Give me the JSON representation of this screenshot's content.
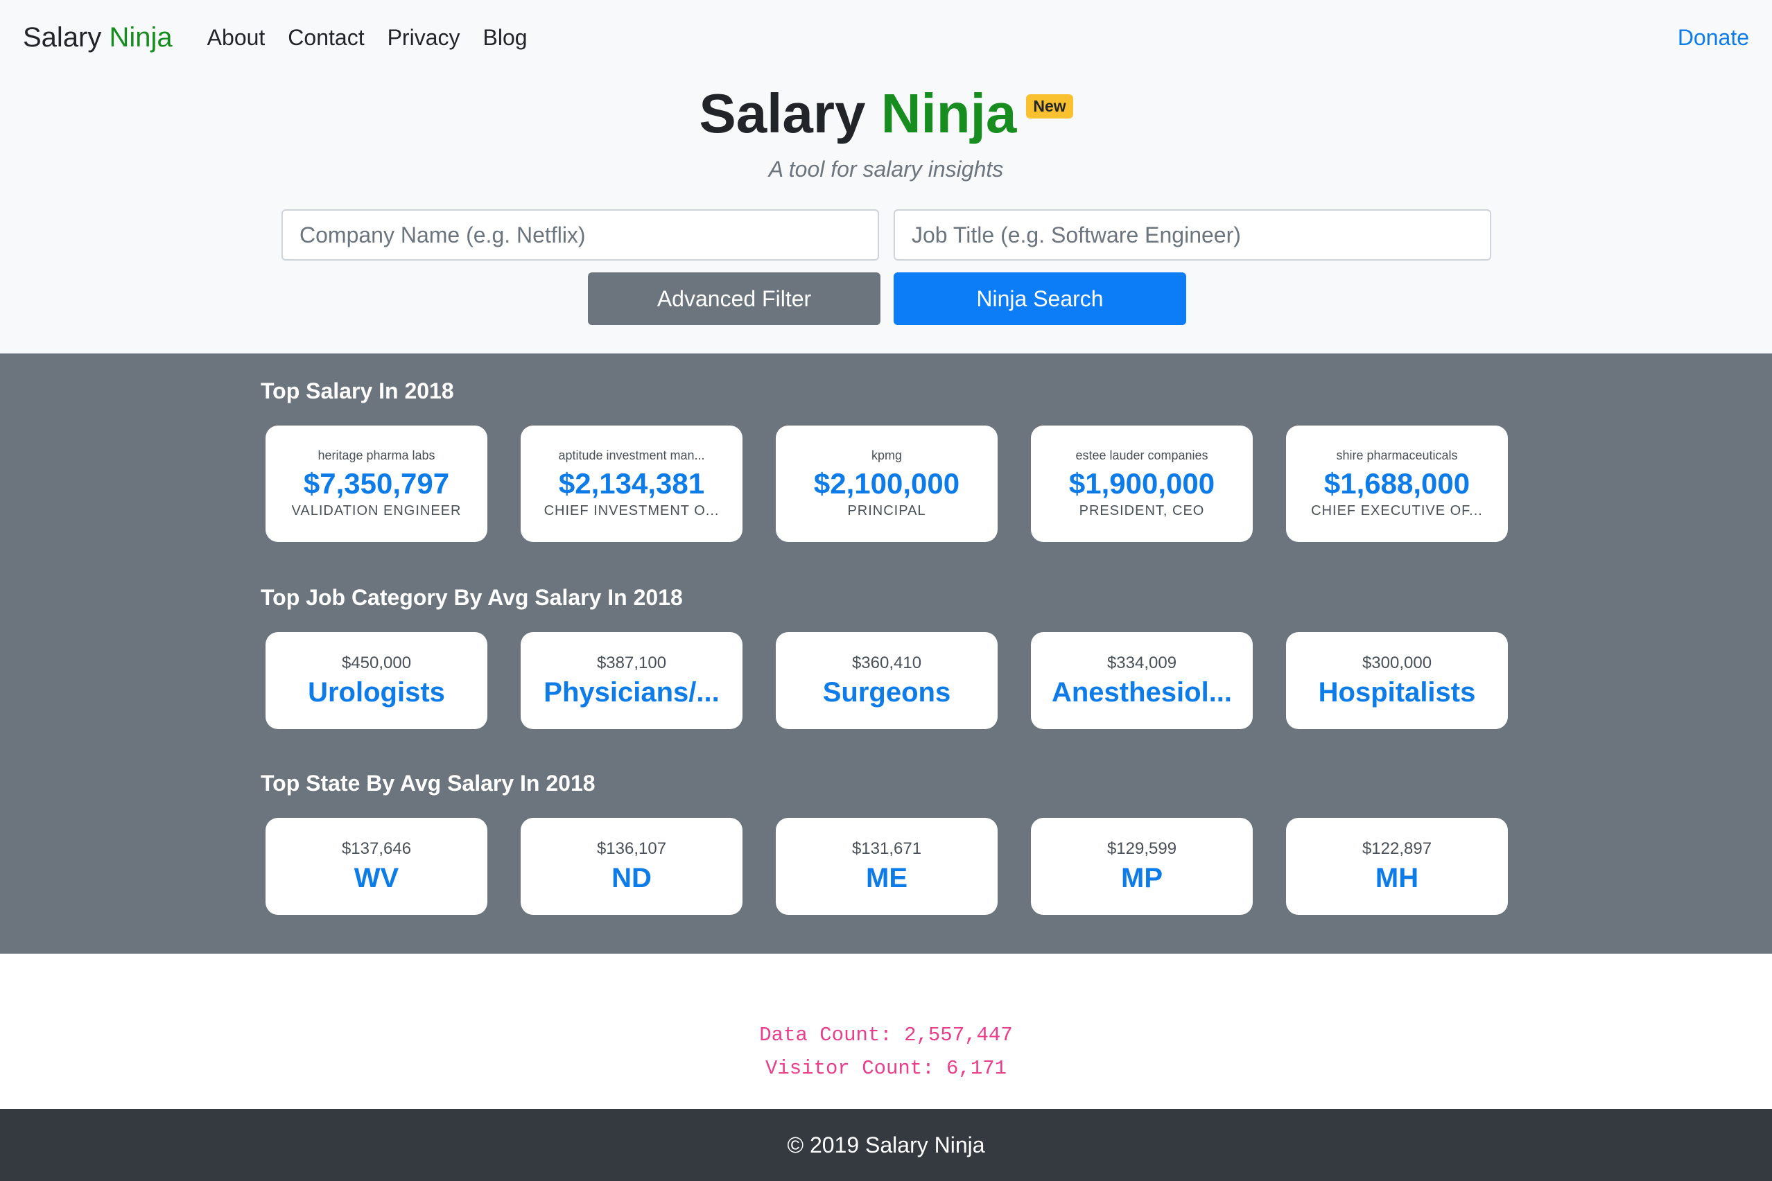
{
  "nav": {
    "brand_main": "Salary",
    "brand_accent": "Ninja",
    "links": [
      "About",
      "Contact",
      "Privacy",
      "Blog"
    ],
    "donate": "Donate"
  },
  "hero": {
    "title_main": "Salary",
    "title_accent": "Ninja",
    "badge": "New",
    "subtitle": "A tool for salary insights",
    "company_placeholder": "Company Name (e.g. Netflix)",
    "job_placeholder": "Job Title (e.g. Software Engineer)",
    "advanced_filter": "Advanced Filter",
    "search": "Ninja Search"
  },
  "top_salary": {
    "title": "Top Salary In 2018",
    "cards": [
      {
        "company": "heritage pharma labs",
        "salary": "$7,350,797",
        "job": "VALIDATION ENGINEER"
      },
      {
        "company": "aptitude investment man...",
        "salary": "$2,134,381",
        "job": "CHIEF INVESTMENT O..."
      },
      {
        "company": "kpmg",
        "salary": "$2,100,000",
        "job": "PRINCIPAL"
      },
      {
        "company": "estee lauder companies",
        "salary": "$1,900,000",
        "job": "PRESIDENT, CEO"
      },
      {
        "company": "shire pharmaceuticals",
        "salary": "$1,688,000",
        "job": "CHIEF EXECUTIVE OF..."
      }
    ]
  },
  "top_category": {
    "title": "Top Job Category By Avg Salary In 2018",
    "cards": [
      {
        "amount": "$450,000",
        "name": "Urologists"
      },
      {
        "amount": "$387,100",
        "name": "Physicians/..."
      },
      {
        "amount": "$360,410",
        "name": "Surgeons"
      },
      {
        "amount": "$334,009",
        "name": "Anesthesiol..."
      },
      {
        "amount": "$300,000",
        "name": "Hospitalists"
      }
    ]
  },
  "top_state": {
    "title": "Top State By Avg Salary In 2018",
    "cards": [
      {
        "amount": "$137,646",
        "name": "WV"
      },
      {
        "amount": "$136,107",
        "name": "ND"
      },
      {
        "amount": "$131,671",
        "name": "ME"
      },
      {
        "amount": "$129,599",
        "name": "MP"
      },
      {
        "amount": "$122,897",
        "name": "MH"
      }
    ]
  },
  "counts": {
    "data_count": "Data Count: 2,557,447",
    "visitor_count": "Visitor Count: 6,171"
  },
  "footer": {
    "text": "© 2019 Salary Ninja"
  },
  "colors": {
    "brand_green": "#188d1f",
    "link_blue": "#0d7ce8",
    "badge_yellow": "#f9c12f",
    "stats_bg": "#6c757d",
    "count_pink": "#e83e8c",
    "footer_bg": "#343a40"
  }
}
